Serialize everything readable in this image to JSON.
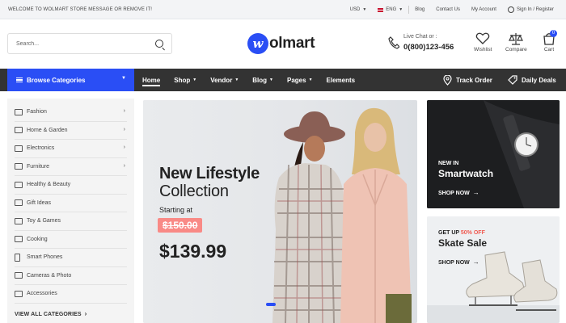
{
  "topbar": {
    "welcome": "WELCOME TO WOLMART STORE MESSAGE OR REMOVE IT!",
    "currency": "USD",
    "language": "ENG",
    "links": [
      "Blog",
      "Contact Us",
      "My Account"
    ],
    "auth": "Sign In / Register"
  },
  "header": {
    "search_placeholder": "Search...",
    "logo_mark": "w",
    "logo_text": "olmart",
    "live_label": "Live Chat or :",
    "phone": "0(800)123-456",
    "wishlist": "Wishlist",
    "compare": "Compare",
    "cart": "Cart",
    "cart_count": "0"
  },
  "nav": {
    "browse": "Browse Categories",
    "items": [
      "Home",
      "Shop",
      "Vendor",
      "Blog",
      "Pages",
      "Elements"
    ],
    "track": "Track Order",
    "deals": "Daily Deals"
  },
  "sidebar": {
    "categories": [
      "Fashion",
      "Home & Garden",
      "Electronics",
      "Furniture",
      "Healthy & Beauty",
      "Gift Ideas",
      "Toy & Games",
      "Cooking",
      "Smart Phones",
      "Cameras & Photo",
      "Accessories"
    ],
    "view_all": "VIEW ALL CATEGORIES"
  },
  "hero": {
    "title_bold": "New Lifestyle",
    "title_light": "Collection",
    "starting": "Starting at",
    "old_price": "$150.00",
    "new_price": "$139.99"
  },
  "promo1": {
    "eyebrow": "NEW IN",
    "title": "Smartwatch",
    "cta": "SHOP NOW"
  },
  "promo2": {
    "eyebrow_prefix": "GET UP ",
    "eyebrow_highlight": "50% OFF",
    "title": "Skate Sale",
    "cta": "SHOP NOW"
  },
  "colors": {
    "accent": "#2a4ef5",
    "nav_bg": "#333333",
    "sale_red": "#f05b51"
  }
}
